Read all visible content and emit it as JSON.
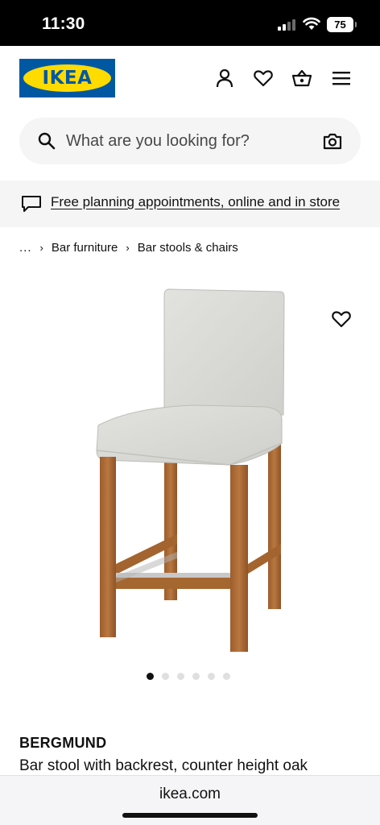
{
  "status_bar": {
    "time": "11:30",
    "battery": "75"
  },
  "header": {
    "logo_text": "IKEA",
    "icons": [
      "profile-icon",
      "heart-icon",
      "basket-icon",
      "menu-icon"
    ],
    "colors": {
      "brand_blue": "#0058a3",
      "brand_yellow": "#ffdb00"
    }
  },
  "search": {
    "placeholder": "What are you looking for?",
    "value": ""
  },
  "banner": {
    "link_text": "Free planning appointments, online and in store"
  },
  "breadcrumb": {
    "ellipsis": "...",
    "items": [
      "Bar furniture",
      "Bar stools & chairs"
    ]
  },
  "product": {
    "name": "BERGMUND",
    "description": "Bar stool with backrest, counter height oak",
    "image_count": 6,
    "active_image": 1
  },
  "browser": {
    "url": "ikea.com"
  }
}
